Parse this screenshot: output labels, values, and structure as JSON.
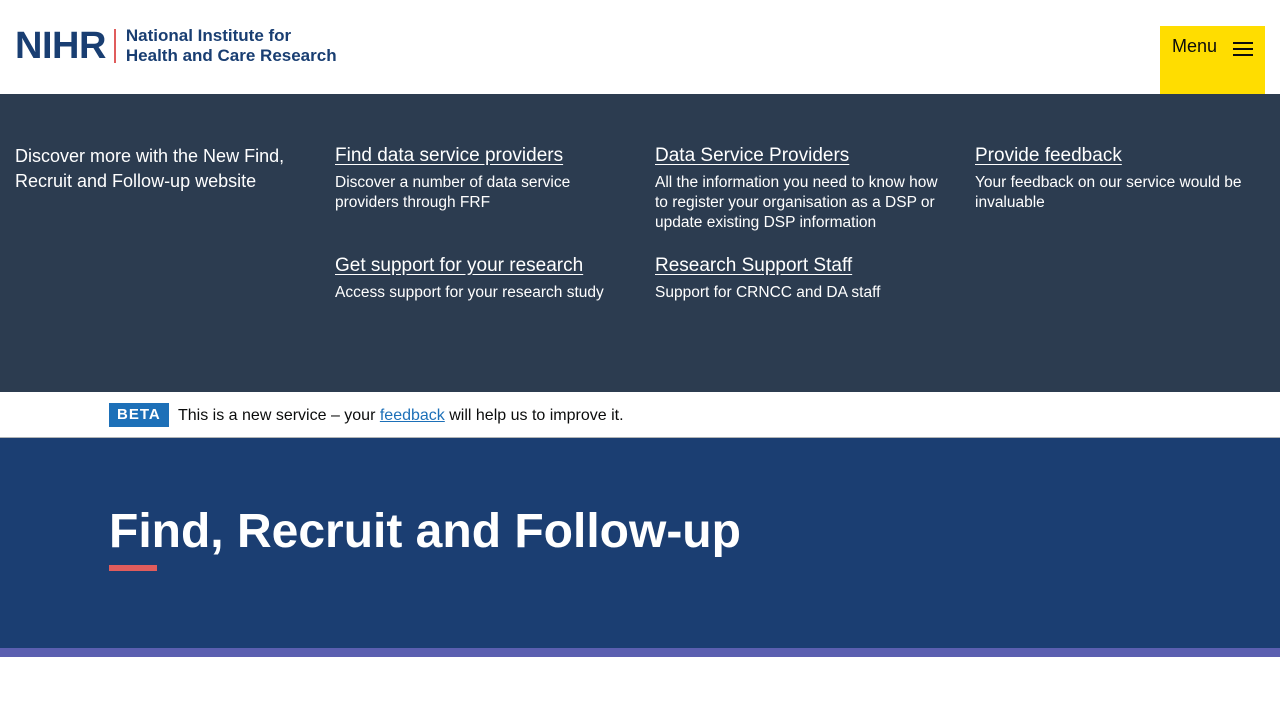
{
  "header": {
    "logo_mark": "NIHR",
    "logo_line1": "National Institute for",
    "logo_line2": "Health and Care Research",
    "menu_label": "Menu"
  },
  "mega_menu": {
    "intro": "Discover more with the New Find, Recruit and Follow-up website",
    "items": [
      {
        "title": "Find data service providers",
        "desc": "Discover a number of data service providers through FRF"
      },
      {
        "title": "Data Service Providers",
        "desc": "All the information you need to know how to register your organisation as a DSP or update existing DSP information"
      },
      {
        "title": "Provide feedback",
        "desc": "Your feedback on our service would be invaluable"
      },
      {
        "title": "Get support for your research",
        "desc": "Access support for your research study"
      },
      {
        "title": "Research Support Staff",
        "desc": "Support for CRNCC and DA staff"
      }
    ]
  },
  "beta": {
    "tag": "BETA",
    "text_before": "This is a new service – your ",
    "link": "feedback",
    "text_after": " will help us to improve it."
  },
  "hero": {
    "title": "Find, Recruit and Follow-up"
  },
  "colors": {
    "header_bg": "#ffffff",
    "mega_bg": "#2c3c50",
    "hero_bg": "#1b3e72",
    "menu_button": "#ffdd00",
    "beta_tag": "#1d70b8",
    "accent": "#e05c5c",
    "strip": "#5b5fb0"
  }
}
